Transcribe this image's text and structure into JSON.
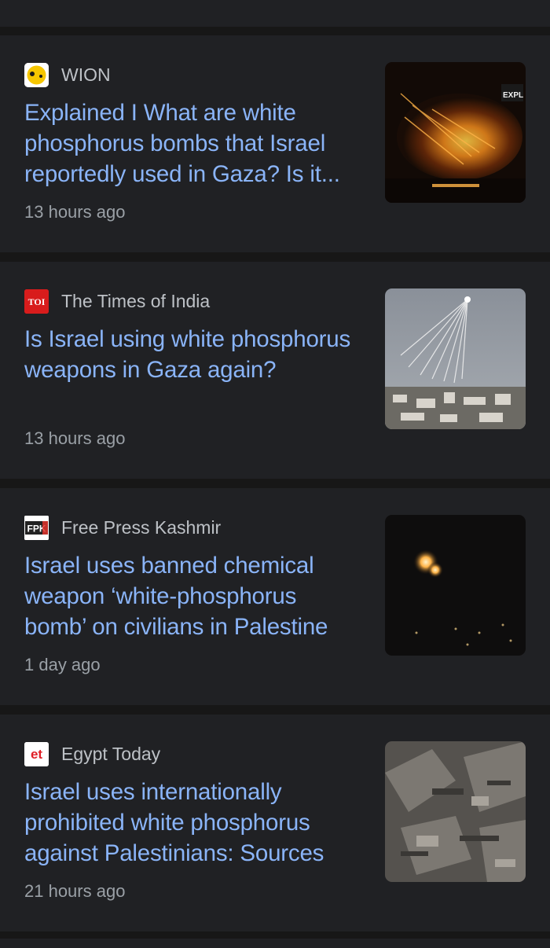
{
  "articles": [
    {
      "source": "WION",
      "favicon_icon": "wion-logo-icon",
      "title": "Explained I What are white phosphorus bombs that Israel reportedly used in Gaza? Is it...",
      "time": "13 hours ago",
      "image_overlay_text": "EXPL"
    },
    {
      "source": "The Times of India",
      "favicon_icon": "toi-logo-icon",
      "favicon_text": "TOI",
      "title": "Is Israel using white phosphorus weapons in Gaza again?",
      "time": "13 hours ago"
    },
    {
      "source": "Free Press Kashmir",
      "favicon_icon": "fpk-logo-icon",
      "favicon_text": "FPK",
      "title": "Israel uses banned chemical weapon ‘white-phosphorus bomb’ on civilians in Palestine",
      "time": "1 day ago"
    },
    {
      "source": "Egypt Today",
      "favicon_icon": "et-logo-icon",
      "favicon_text": "et",
      "title": "Israel uses internationally prohibited white phosphorus against Palestinians: Sources",
      "time": "21 hours ago"
    }
  ],
  "colors": {
    "background": "#171717",
    "card": "#202124",
    "title_link": "#8ab4f8",
    "source_text": "#bdc1c6",
    "time_text": "#9aa0a6"
  }
}
